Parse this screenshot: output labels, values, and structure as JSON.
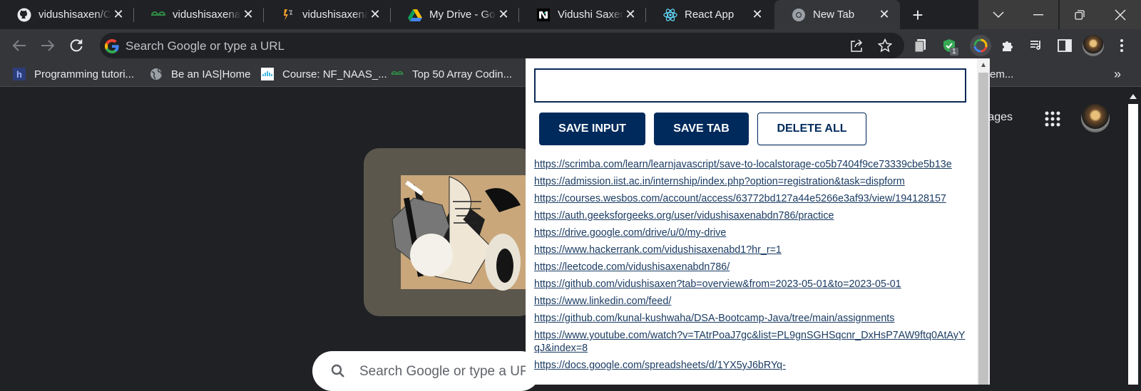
{
  "tabs": [
    {
      "title": "vidushisaxen/C",
      "icon": "github-icon"
    },
    {
      "title": "vidushisaxenab",
      "icon": "geeksforgeeks-icon"
    },
    {
      "title": "vidushisaxenab",
      "icon": "hackerrank-icon"
    },
    {
      "title": "My Drive - Goo",
      "icon": "google-drive-icon"
    },
    {
      "title": "Vidushi Saxena",
      "icon": "notion-icon"
    },
    {
      "title": "React App",
      "icon": "react-icon"
    },
    {
      "title": "New Tab",
      "icon": "chrome-icon",
      "active": true
    }
  ],
  "omnibox": {
    "placeholder": "Search Google or type a URL"
  },
  "extension_badge": "1",
  "bookmarks": [
    {
      "label": "Programming tutori...",
      "icon": "bookmark-favicon"
    },
    {
      "label": "Be an IAS|Home",
      "icon": "globe-icon"
    },
    {
      "label": "Course: NF_NAAS_...",
      "icon": "cisco-icon"
    },
    {
      "label": "Top 50 Array Codin...",
      "icon": "geeksforgeeks-icon"
    }
  ],
  "bookmarks_overflow_partial": "em...",
  "newtab": {
    "search_placeholder": "Search Google or type a UR",
    "images_link": "mages"
  },
  "popup": {
    "input_value": "",
    "buttons": {
      "save_input": "SAVE INPUT",
      "save_tab": "SAVE TAB",
      "delete_all": "DELETE ALL"
    },
    "links": [
      "https://scrimba.com/learn/learnjavascript/save-to-localstorage-co5b7404f9ce73339cbe5b13e",
      "https://admission.iist.ac.in/internship/index.php?option=registration&task=dispform",
      "https://courses.wesbos.com/account/access/63772bd127a44e5266e3af93/view/194128157",
      "https://auth.geeksforgeeks.org/user/vidushisaxenabdn786/practice",
      "https://drive.google.com/drive/u/0/my-drive",
      "https://www.hackerrank.com/vidushisaxenabd1?hr_r=1",
      "https://leetcode.com/vidushisaxenabdn786/",
      "https://github.com/vidushisaxen?tab=overview&from=2023-05-01&to=2023-05-01",
      "https://www.linkedin.com/feed/",
      "https://github.com/kunal-kushwaha/DSA-Bootcamp-Java/tree/main/assignments",
      "https://www.youtube.com/watch?v=TAtrPoaJ7gc&list=PL9gnSGHSqcnr_DxHsP7AW9ftq0AtAyYqJ&index=8",
      "https://docs.google.com/spreadsheets/d/1YX5yJ6bRYq-"
    ]
  }
}
